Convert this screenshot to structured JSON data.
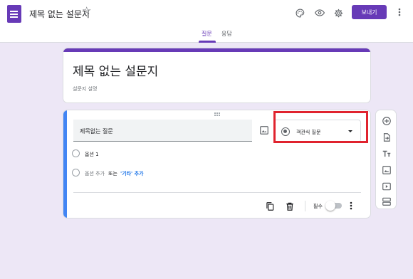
{
  "header": {
    "doc_title": "제목 없는 설문지",
    "send_label": "보내기",
    "brand_color": "#673ab7",
    "icons": [
      "forms-app-icon",
      "star-icon",
      "palette-icon",
      "eye-preview-icon",
      "gear-icon",
      "more-vert-icon"
    ]
  },
  "tabs": [
    {
      "label": "질문",
      "active": true
    },
    {
      "label": "응답",
      "active": false
    }
  ],
  "form": {
    "title": "제목 없는 설문지",
    "description_placeholder": "설문지 설명"
  },
  "question": {
    "title_text": "제목없는 질문",
    "type_label": "객관식 질문",
    "options": [
      {
        "label": "옵션 1"
      }
    ],
    "add_option_label": "옵션 추가",
    "or_label": "또는",
    "add_other_label": "'기타' 추가",
    "required_label": "필수",
    "required_on": false,
    "accent_color": "#4285f4",
    "highlight_color": "#e0232e"
  },
  "side_toolbar": {
    "icons": [
      "add-question-icon",
      "import-question-icon",
      "add-title-icon",
      "add-image-icon",
      "add-video-icon",
      "add-section-icon"
    ]
  }
}
